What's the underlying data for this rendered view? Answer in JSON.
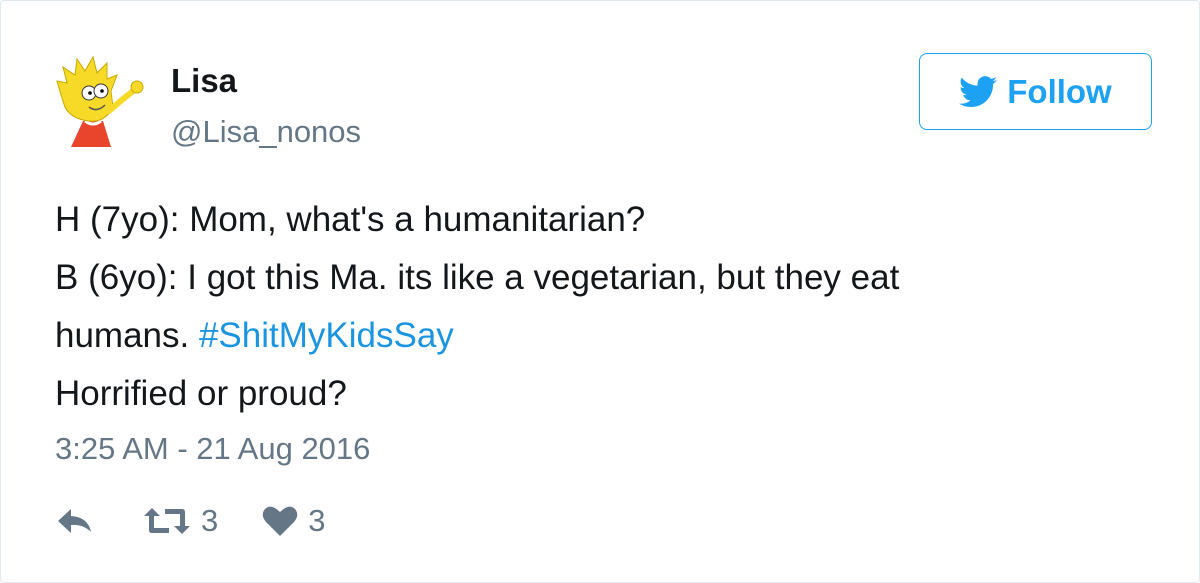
{
  "user": {
    "display_name": "Lisa",
    "screen_name": "@Lisa_nonos"
  },
  "follow_button": {
    "label": "Follow",
    "icon": "twitter-bird-icon",
    "color": "#1da1f2"
  },
  "tweet": {
    "line1": "H (7yo): Mom, what's a humanitarian?",
    "line2": "B (6yo): I got this Ma. its like a vegetarian, but they eat",
    "line3_text": "humans. ",
    "hashtag": "#ShitMyKidsSay",
    "line4": "Horrified or proud?"
  },
  "timestamp": "3:25 AM - 21 Aug 2016",
  "actions": {
    "reply_icon": "reply-icon",
    "retweet_icon": "retweet-icon",
    "retweet_count": "3",
    "like_icon": "heart-icon",
    "like_count": "3"
  },
  "colors": {
    "text": "#14171a",
    "secondary": "#657786",
    "link": "#1b95e0",
    "border": "#e1e8ed"
  }
}
